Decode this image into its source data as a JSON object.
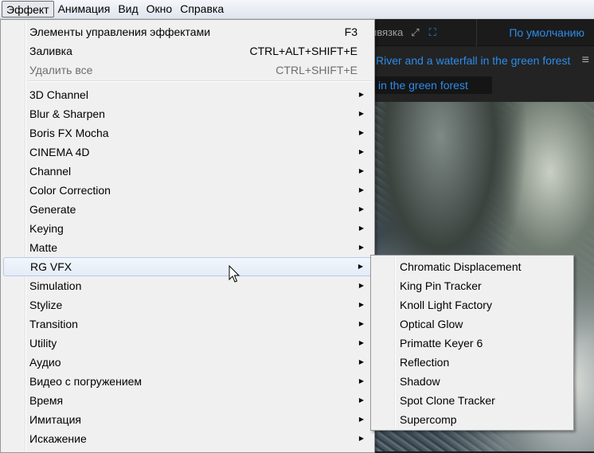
{
  "menubar": [
    "Эффект",
    "Анимация",
    "Вид",
    "Окно",
    "Справка"
  ],
  "toolbar": {
    "snap": "ивязка",
    "default": "По умолчанию"
  },
  "panel": {
    "title": "River and a waterfall in the green forest",
    "tab": "in the green forest"
  },
  "effect_menu": {
    "top": [
      {
        "label": "Элементы управления эффектами",
        "shortcut": "F3",
        "disabled": false
      },
      {
        "label": "Заливка",
        "shortcut": "CTRL+ALT+SHIFT+E",
        "disabled": false
      },
      {
        "label": "Удалить все",
        "shortcut": "CTRL+SHIFT+E",
        "disabled": true
      }
    ],
    "categories": [
      "3D Channel",
      "Blur & Sharpen",
      "Boris FX Mocha",
      "CINEMA 4D",
      "Channel",
      "Color Correction",
      "Generate",
      "Keying",
      "Matte",
      "RG VFX",
      "Simulation",
      "Stylize",
      "Transition",
      "Utility",
      "Аудио",
      "Видео с погружением",
      "Время",
      "Имитация",
      "Искажение"
    ],
    "highlighted": "RG VFX"
  },
  "submenu": [
    "Chromatic Displacement",
    "King Pin Tracker",
    "Knoll Light Factory",
    "Optical Glow",
    "Primatte Keyer 6",
    "Reflection",
    "Shadow",
    "Spot Clone Tracker",
    "Supercomp"
  ]
}
